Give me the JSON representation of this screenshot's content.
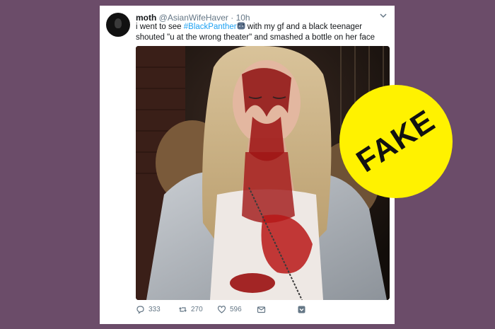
{
  "tweet": {
    "display_name": "moth",
    "handle": "@AsianWifeHaver",
    "separator": "·",
    "time": "10h",
    "text_before": "i went to see ",
    "hashtag": "#BlackPanther",
    "text_after": " with my gf and a black teenager shouted \"u at the wrong theater\" and smashed a bottle on her face"
  },
  "actions": {
    "reply_count": "333",
    "retweet_count": "270",
    "like_count": "596"
  },
  "stamp": {
    "label": "FAKE",
    "color": "#fff200"
  },
  "colors": {
    "background": "#6b4c69",
    "link": "#1da1f2"
  },
  "icons": [
    "chevron-down-icon",
    "panther-emoji-icon",
    "reply-icon",
    "retweet-icon",
    "like-icon",
    "dm-icon",
    "more-icon"
  ]
}
